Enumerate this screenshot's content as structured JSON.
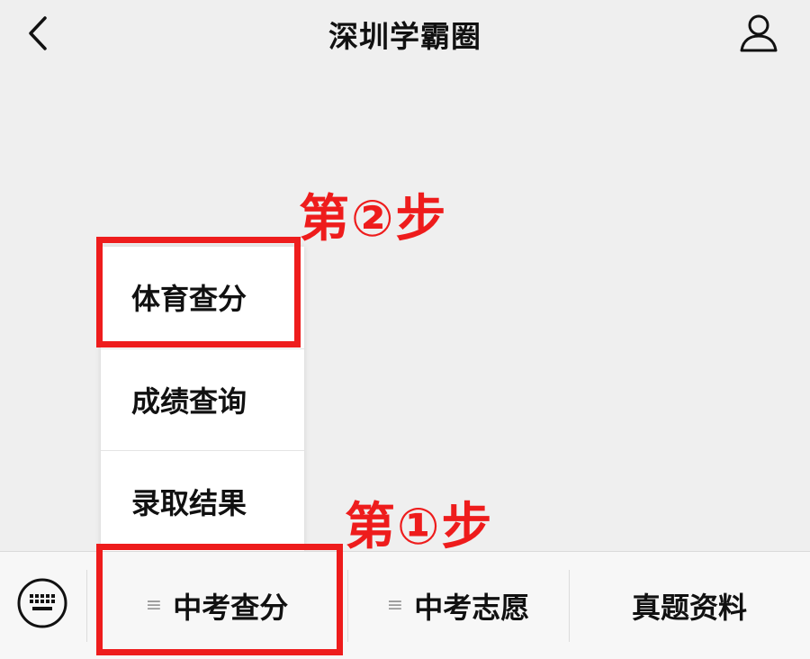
{
  "header": {
    "title": "深圳学霸圈",
    "back_icon": "chevron-left-icon",
    "user_icon": "user-icon"
  },
  "popup_menu": {
    "items": [
      {
        "label": "体育查分"
      },
      {
        "label": "成绩查询"
      },
      {
        "label": "录取结果"
      }
    ]
  },
  "annotations": {
    "step1": "第①步",
    "step2": "第②步",
    "color": "#ee1c1c"
  },
  "bottom_bar": {
    "keyboard_icon": "keyboard-icon",
    "tabs": [
      {
        "label": "中考查分",
        "icon": "≡"
      },
      {
        "label": "中考志愿",
        "icon": "≡"
      },
      {
        "label": "真题资料"
      }
    ]
  }
}
